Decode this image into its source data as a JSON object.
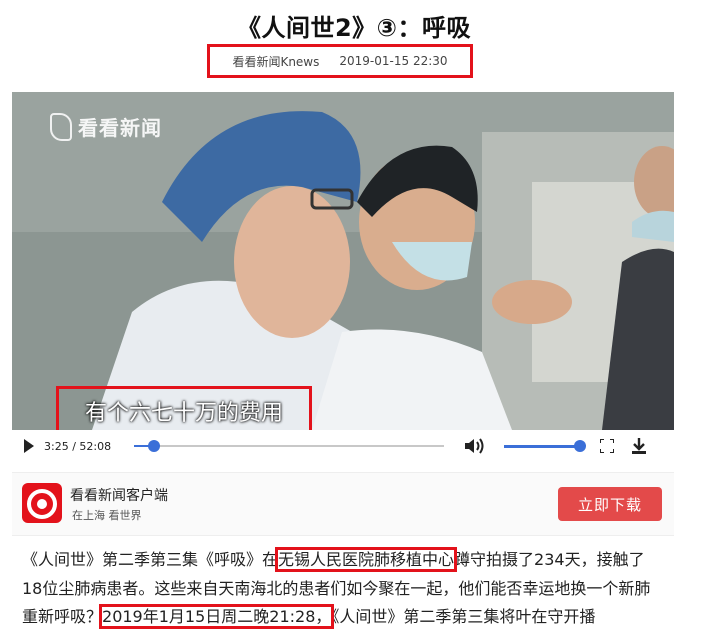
{
  "article": {
    "title": "《人间世2》③：呼吸",
    "source": "看看新闻Knews",
    "datetime": "2019-01-15 22:30"
  },
  "video": {
    "watermark": "看看新闻",
    "subtitle": "有个六七十万的费用",
    "time_display": "3:25 / 52:08",
    "progress": 0.066,
    "volume": 1.0
  },
  "app_banner": {
    "name": "看看新闻客户端",
    "slogan": "在上海  看世界",
    "download_label": "立即下载"
  },
  "body": {
    "p1_before": "《人间世》第二季第三集《呼吸》在",
    "p1_highlight1": "无锡人民医院肺移植中心",
    "p1_middle": "蹲守拍摄了234天，接触了18位尘肺病患者。这些来自天南海北的患者们如今聚在一起，他们能否幸运地换一个新肺重新呼吸？",
    "p1_highlight2": "2019年1月15日周二晚21:28，",
    "p1_after": "《人间世》第二季第三集将叶在守开播"
  },
  "colors": {
    "highlight": "#e3121b",
    "accent": "#3b6fd8",
    "button": "#e34a4a"
  }
}
